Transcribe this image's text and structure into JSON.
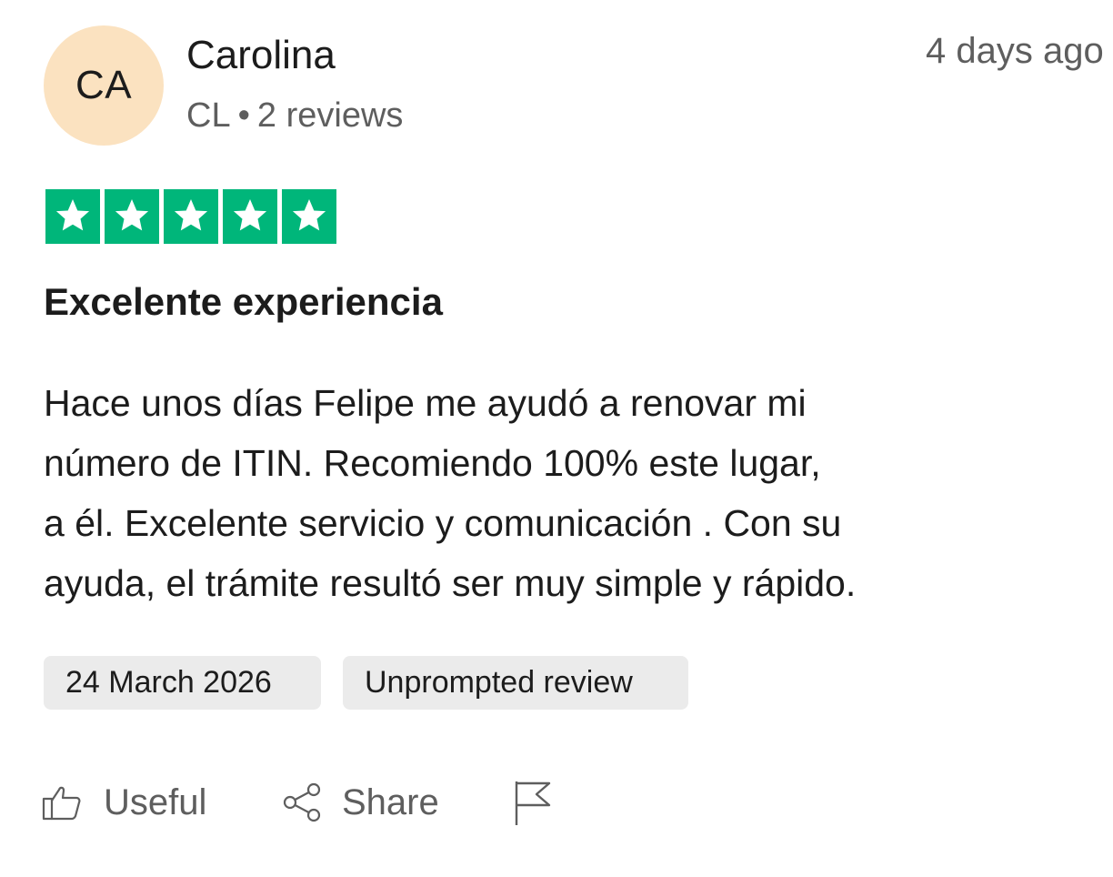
{
  "reviewer": {
    "initials": "CA",
    "name": "Carolina",
    "country": "CL",
    "separator": "•",
    "review_count": "2 reviews",
    "avatar_color": "#fbe2c0"
  },
  "posted_ago": "4 days ago",
  "rating": {
    "value": 5,
    "max": 5,
    "star_color": "#00b67a"
  },
  "review": {
    "title": "Excelente experiencia",
    "body_lines": [
      "Hace unos días Felipe me ayudó a renovar mi",
      "número de ITIN. Recomiendo 100% este lugar,",
      "a él. Excelente servicio y comunicación . Con su",
      "ayuda, el trámite resultó ser muy simple y rápido."
    ]
  },
  "tags": {
    "date": "24 March 2026",
    "unprompted": "Unprompted review"
  },
  "actions": {
    "useful": "Useful",
    "share": "Share",
    "useful_icon": "thumbs-up-icon",
    "share_icon": "share-icon",
    "flag_icon": "flag-icon"
  }
}
